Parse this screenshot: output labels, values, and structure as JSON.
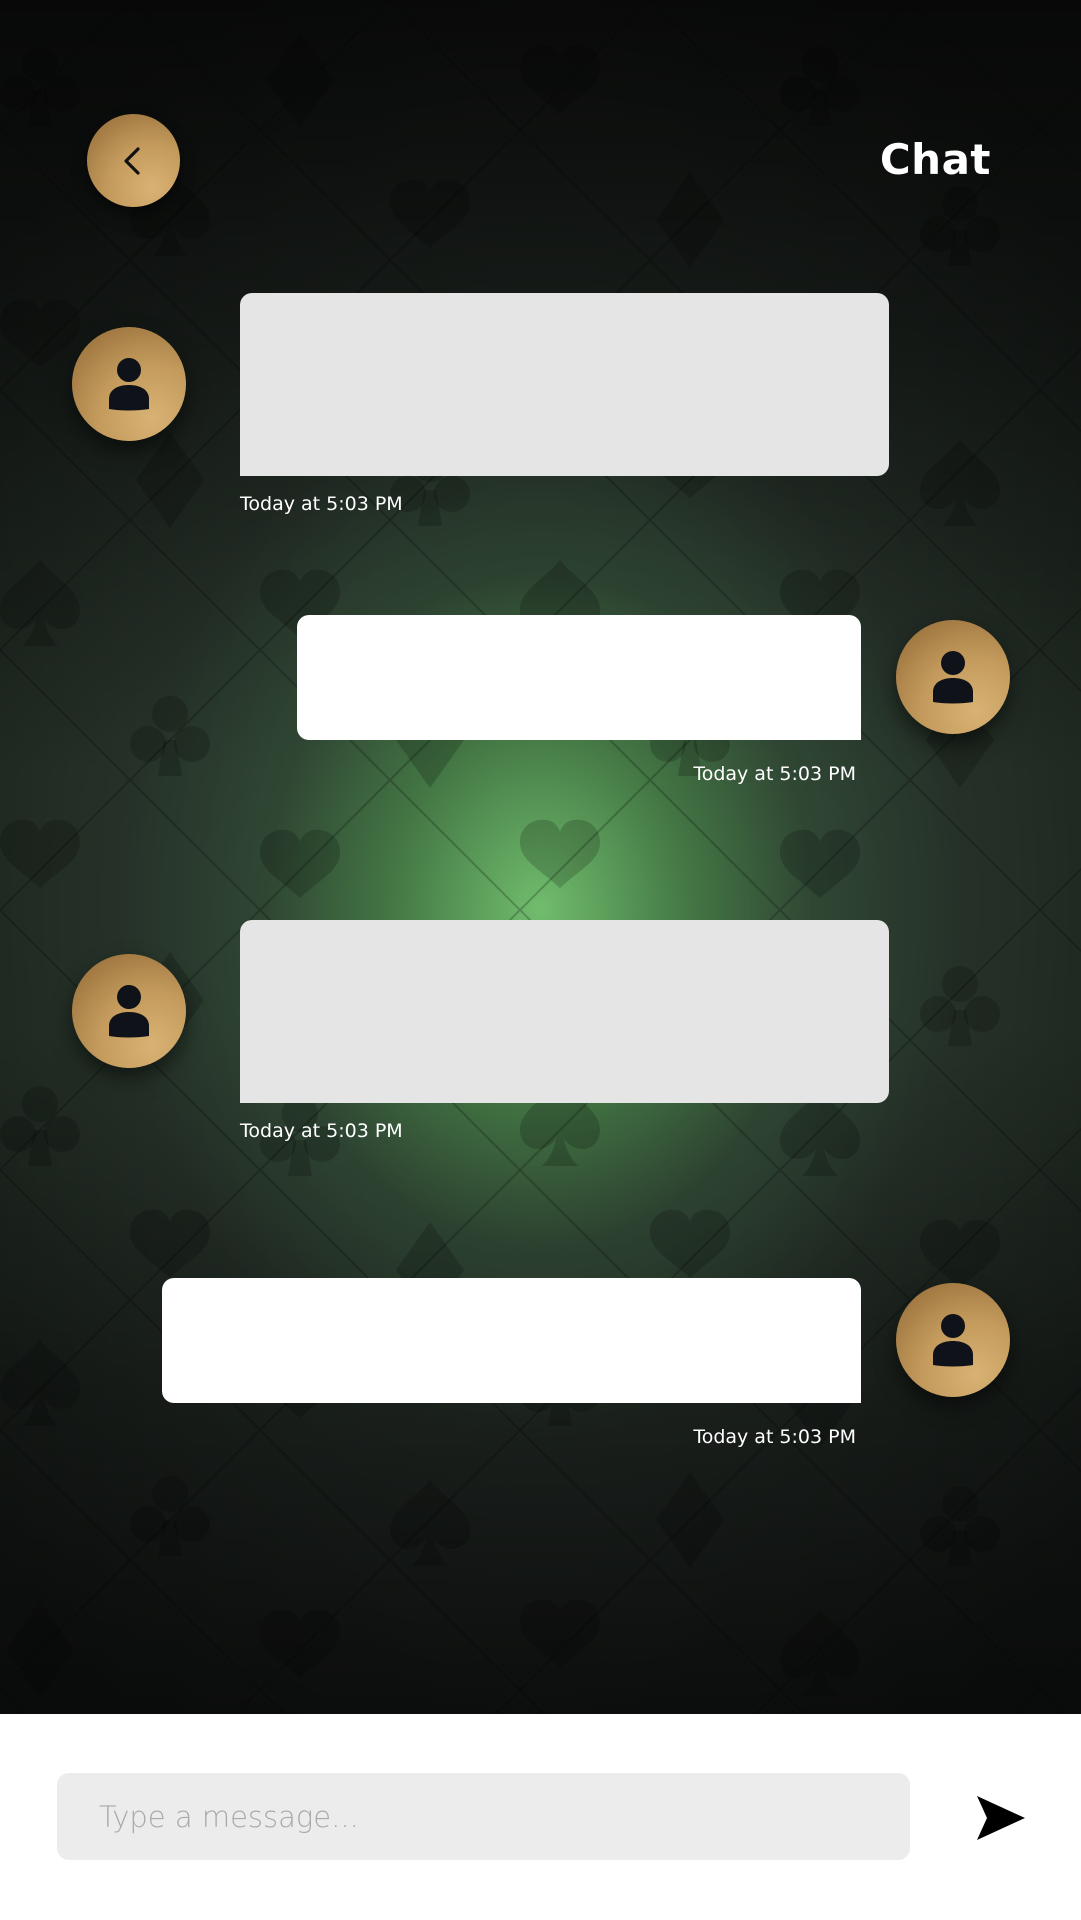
{
  "header": {
    "title": "Chat",
    "back_icon": "chevron-left-icon"
  },
  "messages": [
    {
      "direction": "received",
      "timestamp": "Today at 5:03 PM",
      "avatar_icon": "user-icon"
    },
    {
      "direction": "sent",
      "timestamp": "Today at 5:03 PM",
      "avatar_icon": "user-icon"
    },
    {
      "direction": "received",
      "timestamp": "Today at 5:03 PM",
      "avatar_icon": "user-icon"
    },
    {
      "direction": "sent",
      "timestamp": "Today at 5:03 PM",
      "avatar_icon": "user-icon"
    }
  ],
  "composer": {
    "placeholder": "Type a message...",
    "send_icon": "send-icon"
  },
  "colors": {
    "gold_accent": "#c39a5c",
    "received_bubble": "#e5e5e5",
    "sent_bubble": "#ffffff",
    "input_background": "#ececec"
  }
}
